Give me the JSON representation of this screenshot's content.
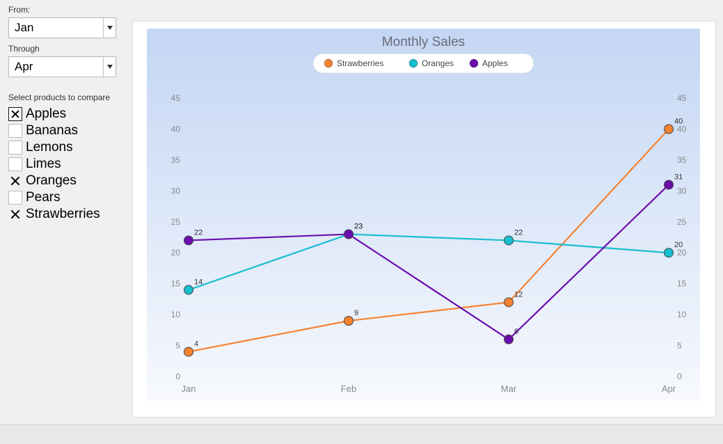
{
  "controls": {
    "from_label": "From:",
    "from_value": "Jan",
    "through_label": "Through",
    "through_value": "Apr",
    "compare_label": "Select products to compare",
    "products": [
      {
        "name": "Apples",
        "checked": true,
        "focused": true
      },
      {
        "name": "Bananas",
        "checked": false,
        "focused": false
      },
      {
        "name": "Lemons",
        "checked": false,
        "focused": false
      },
      {
        "name": "Limes",
        "checked": false,
        "focused": false
      },
      {
        "name": "Oranges",
        "checked": true,
        "focused": false
      },
      {
        "name": "Pears",
        "checked": false,
        "focused": false
      },
      {
        "name": "Strawberries",
        "checked": true,
        "focused": false
      }
    ]
  },
  "chart_data": {
    "type": "line",
    "title": "Monthly Sales",
    "xlabel": "",
    "ylabel": "",
    "categories": [
      "Jan",
      "Feb",
      "Mar",
      "Apr"
    ],
    "series": [
      {
        "name": "Strawberries",
        "values": [
          4,
          9,
          12,
          40
        ],
        "color": "#f58231"
      },
      {
        "name": "Oranges",
        "values": [
          14,
          23,
          22,
          20
        ],
        "color": "#17becf"
      },
      {
        "name": "Apples",
        "values": [
          22,
          23,
          6,
          31
        ],
        "color": "#6a0dad"
      }
    ],
    "ylim": [
      0,
      45
    ],
    "y_ticks": [
      0,
      5,
      10,
      15,
      20,
      25,
      30,
      35,
      40,
      45
    ],
    "legend_position": "top"
  }
}
